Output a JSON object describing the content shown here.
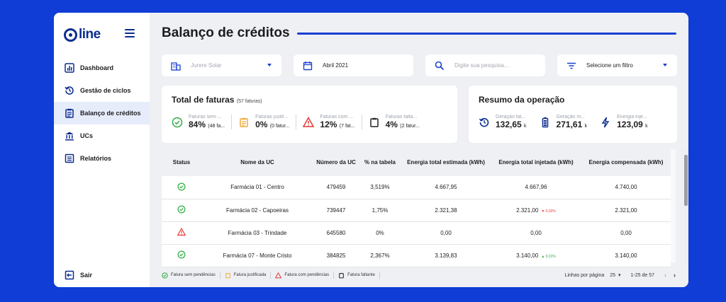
{
  "sidebar": {
    "logo": "line",
    "items": [
      {
        "label": "Dashboard",
        "icon": "bar-chart-icon"
      },
      {
        "label": "Gestão de ciclos",
        "icon": "cycle-icon"
      },
      {
        "label": "Balanço de créditos",
        "icon": "clipboard-icon",
        "active": true
      },
      {
        "label": "UCs",
        "icon": "building-icon"
      },
      {
        "label": "Relatórios",
        "icon": "report-icon"
      }
    ],
    "logout": "Sair"
  },
  "header": {
    "title": "Balanço de créditos"
  },
  "filters": {
    "company": "Jurere Solar",
    "month": "Abril 2021",
    "search_placeholder": "Digite sua pesquisa...",
    "filter_label": "Selecione um filtro"
  },
  "totals": {
    "title": "Total de faturas",
    "count": "(57 faturas)",
    "stats": [
      {
        "label": "Faturas sem ...",
        "value": "84%",
        "detail": "(48 fa..."
      },
      {
        "label": "Faturas justif...",
        "value": "0%",
        "detail": "(0 fatur..."
      },
      {
        "label": "Faturas com ...",
        "value": "12%",
        "detail": "(7 fat..."
      },
      {
        "label": "Faturas falta...",
        "value": "4%",
        "detail": "(2 fatur..."
      }
    ]
  },
  "summary": {
    "title": "Resumo da operação",
    "stats": [
      {
        "label": "Geração fat...",
        "value": "132,65",
        "unit": "k"
      },
      {
        "label": "Geração m...",
        "value": "271,61",
        "unit": "k"
      },
      {
        "label": "Energia inje...",
        "value": "123,09",
        "unit": "k"
      }
    ]
  },
  "table": {
    "headers": [
      "Status",
      "Nome da UC",
      "Número da UC",
      "% na tabela",
      "Energia total estimada (kWh)",
      "Energia total injetada (kWh)",
      "Energia compensada (kWh)"
    ],
    "rows": [
      {
        "status": "ok",
        "name": "Farmácia 01 - Centro",
        "number": "479459",
        "pct": "3,519%",
        "estimated": "4.667,95",
        "injected": "4.667,96",
        "delta": "",
        "compensated": "4.740,00"
      },
      {
        "status": "ok",
        "name": "Farmácia 02 - Capoeiras",
        "number": "739447",
        "pct": "1,75%",
        "estimated": "2.321,38",
        "injected": "2.321,00",
        "delta": "▼ 0,02%",
        "compensated": "2.321,00"
      },
      {
        "status": "warn",
        "name": "Farmácia 03 - Trindade",
        "number": "645580",
        "pct": "0%",
        "estimated": "0,00",
        "injected": "0,00",
        "delta": "",
        "compensated": "0,00"
      },
      {
        "status": "ok",
        "name": "Farmácia 07 - Monte Cristo",
        "number": "384825",
        "pct": "2,367%",
        "estimated": "3.139,83",
        "injected": "3.140,00",
        "delta": "▲ 0,01%",
        "compensated": "3.140,00"
      }
    ]
  },
  "legend": [
    "Fatura sem pendências",
    "Fatura justificada",
    "Fatura com pendências",
    "Fatura faltante"
  ],
  "pager": {
    "rows_label": "Linhas por página",
    "rows_value": "25",
    "range": "1-25 de 57"
  },
  "colors": {
    "primary": "#1a3fd1",
    "ok": "#2eab3f",
    "warn": "#e53935",
    "justified": "#f2a93b",
    "up": "#2eab3f",
    "down": "#e53935"
  }
}
